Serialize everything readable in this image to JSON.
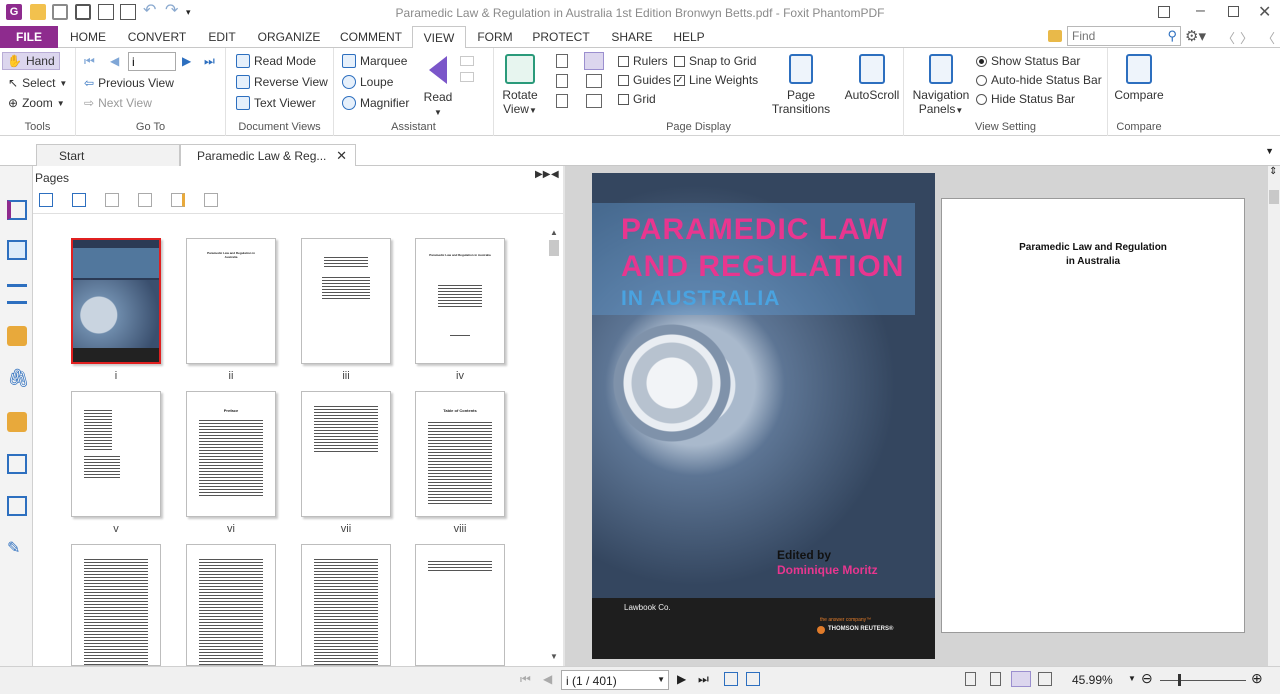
{
  "window": {
    "title": "Paramedic Law & Regulation in Australia 1st Edition Bronwyn Betts.pdf - Foxit PhantomPDF"
  },
  "search": {
    "placeholder": "Find"
  },
  "ribbon_tabs": [
    "FILE",
    "HOME",
    "CONVERT",
    "EDIT",
    "ORGANIZE",
    "COMMENT",
    "VIEW",
    "FORM",
    "PROTECT",
    "SHARE",
    "HELP"
  ],
  "active_tab": "VIEW",
  "groups": {
    "tools": {
      "label": "Tools",
      "hand": "Hand",
      "select": "Select",
      "zoom": "Zoom"
    },
    "goto": {
      "label": "Go To",
      "page_value": "i",
      "previous_view": "Previous View",
      "next_view": "Next View"
    },
    "document_views": {
      "label": "Document Views",
      "read_mode": "Read Mode",
      "reverse_view": "Reverse View",
      "text_viewer": "Text Viewer"
    },
    "assistant": {
      "label": "Assistant",
      "marquee": "Marquee",
      "loupe": "Loupe",
      "magnifier": "Magnifier",
      "read": "Read"
    },
    "page_display": {
      "label": "Page Display",
      "rotate_view": "Rotate View",
      "rulers": "Rulers",
      "guides": "Guides",
      "grid": "Grid",
      "snap_to_grid": "Snap to Grid",
      "line_weights": "Line Weights",
      "page_transitions": "Page Transitions",
      "autoscroll": "AutoScroll"
    },
    "view_setting": {
      "label": "View Setting",
      "navigation_panels": "Navigation Panels",
      "show_status_bar": "Show Status Bar",
      "auto_hide_status_bar": "Auto-hide Status Bar",
      "hide_status_bar": "Hide Status Bar"
    },
    "compare": {
      "label": "Compare",
      "compare": "Compare"
    }
  },
  "doc_tabs": {
    "start": "Start",
    "current": "Paramedic Law & Reg..."
  },
  "pages_panel": {
    "title": "Pages",
    "thumb_labels": [
      "i",
      "ii",
      "iii",
      "iv",
      "v",
      "vi",
      "vii",
      "viii",
      "",
      "",
      "",
      ""
    ]
  },
  "thumbs": {
    "t2_title": "Paramedic Law and Regulation in Australia",
    "t4_title": "Paramedic Law and Regulation in Australia",
    "t6_title": "Preface",
    "t8_title": "Table of Contents"
  },
  "cover": {
    "title_line1": "PARAMEDIC LAW",
    "title_line2": "AND REGULATION",
    "title_line3": "IN AUSTRALIA",
    "edited_by": "Edited by",
    "editor": "Dominique Moritz",
    "publisher": "Lawbook Co.",
    "tagline": "the answer company™",
    "brand": "THOMSON REUTERS®"
  },
  "page2": {
    "title_line1": "Paramedic Law and Regulation",
    "title_line2": "in Australia"
  },
  "status": {
    "page_indicator": "i (1 / 401)",
    "zoom": "45.99%"
  },
  "colors": {
    "file_tab": "#8e2b8e",
    "accent": "#2d6fbf",
    "cover_pink": "#e8368f",
    "cover_blue": "#4aa3e0"
  }
}
